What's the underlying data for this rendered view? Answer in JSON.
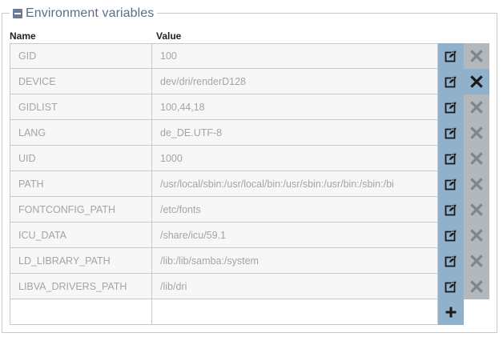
{
  "panel": {
    "legend": "Environment variables",
    "columns": {
      "name": "Name",
      "value": "Value"
    }
  },
  "env_vars": [
    {
      "name": "GID",
      "value": "100"
    },
    {
      "name": "DEVICE",
      "value": "dev/dri/renderD128"
    },
    {
      "name": "GIDLIST",
      "value": "100,44,18"
    },
    {
      "name": "LANG",
      "value": "de_DE.UTF-8"
    },
    {
      "name": "UID",
      "value": "1000"
    },
    {
      "name": "PATH",
      "value": "/usr/local/sbin:/usr/local/bin:/usr/sbin:/usr/bin:/sbin:/bi"
    },
    {
      "name": "FONTCONFIG_PATH",
      "value": "/etc/fonts"
    },
    {
      "name": "ICU_DATA",
      "value": "/share/icu/59.1"
    },
    {
      "name": "LD_LIBRARY_PATH",
      "value": "/lib:/lib/samba:/system"
    },
    {
      "name": "LIBVA_DRIVERS_PATH",
      "value": "/lib/dri"
    }
  ],
  "new_entry": {
    "name": "",
    "value": ""
  },
  "icons": {
    "edit": "edit-icon",
    "delete": "delete-icon",
    "add": "plus-icon",
    "collapse": "minus-icon"
  },
  "colors": {
    "action_blue": "#8fb1cc",
    "action_gray": "#b3b8bc",
    "legend_text": "#5a6f86"
  },
  "hovered_delete_row": 1
}
